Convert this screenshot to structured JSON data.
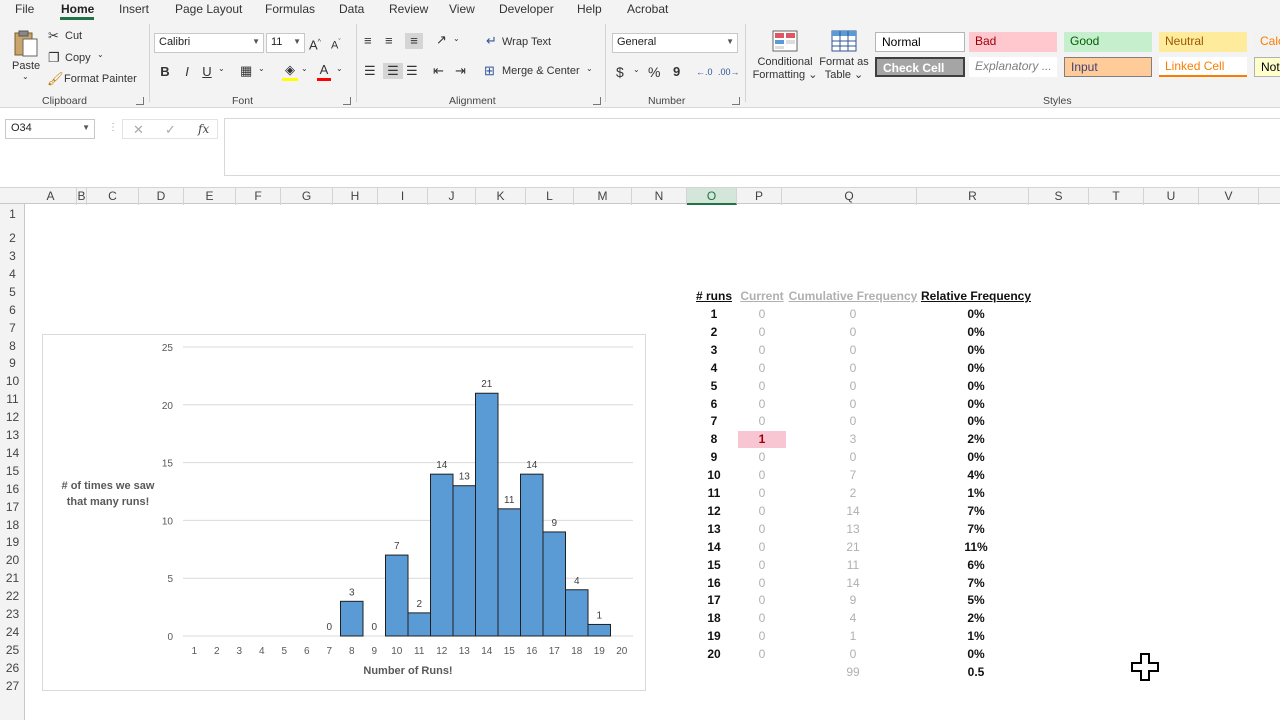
{
  "menu": [
    "File",
    "Home",
    "Insert",
    "Page Layout",
    "Formulas",
    "Data",
    "Review",
    "View",
    "Developer",
    "Help",
    "Acrobat"
  ],
  "ribbon": {
    "clipboard": {
      "paste": "Paste",
      "cut": "Cut",
      "copy": "Copy",
      "format_painter": "Format Painter",
      "label": "Clipboard"
    },
    "font": {
      "name": "Calibri",
      "size": "11",
      "bold": "B",
      "italic": "I",
      "underline": "U",
      "label": "Font"
    },
    "alignment": {
      "wrap_text": "Wrap Text",
      "merge_center": "Merge & Center",
      "label": "Alignment"
    },
    "number": {
      "format": "General",
      "currency": "$",
      "percent": "%",
      "comma": "9",
      "label": "Number"
    },
    "styles": {
      "conditional_formatting": [
        "Conditional",
        "Formatting"
      ],
      "format_as_table": [
        "Format as",
        "Table"
      ],
      "label": "Styles",
      "cells": [
        {
          "text": "Normal",
          "bg": "#ffffff",
          "color": "#000000"
        },
        {
          "text": "Bad",
          "bg": "#ffc7ce",
          "color": "#9c0006"
        },
        {
          "text": "Good",
          "bg": "#c6efce",
          "color": "#006100"
        },
        {
          "text": "Neutral",
          "bg": "#ffeb9c",
          "color": "#9c5700"
        },
        {
          "text": "Calc",
          "bg": "#f2f2f2",
          "color": "#fa7d00"
        },
        {
          "text": "Check Cell",
          "bg": "#a5a5a5",
          "color": "#ffffff"
        },
        {
          "text": "Explanatory ...",
          "bg": "#ffffff",
          "color": "#7f7f7f"
        },
        {
          "text": "Input",
          "bg": "#ffcc99",
          "color": "#3f3f76"
        },
        {
          "text": "Linked Cell",
          "bg": "#ffffff",
          "color": "#fa7d00"
        },
        {
          "text": "Note",
          "bg": "#ffffcc",
          "color": "#000000"
        }
      ]
    }
  },
  "formula_bar": {
    "name_box": "O34",
    "fx": "fx",
    "formula": ""
  },
  "columns": [
    "A",
    "B",
    "C",
    "D",
    "E",
    "F",
    "G",
    "H",
    "I",
    "J",
    "K",
    "L",
    "M",
    "N",
    "O",
    "P",
    "Q",
    "R",
    "S",
    "T",
    "U",
    "V"
  ],
  "selected_column": "O",
  "rows": [
    "1",
    "2",
    "3",
    "4",
    "5",
    "6",
    "7",
    "8",
    "9",
    "10",
    "11",
    "12",
    "13",
    "14",
    "15",
    "16",
    "17",
    "18",
    "19",
    "20",
    "21",
    "22",
    "23",
    "24",
    "25",
    "26",
    "27"
  ],
  "table": {
    "headers": [
      "# runs",
      "Current",
      "Cumulative Frequency",
      "Relative Frequency"
    ],
    "rows": [
      [
        "1",
        "0",
        "0",
        "0%"
      ],
      [
        "2",
        "0",
        "0",
        "0%"
      ],
      [
        "3",
        "0",
        "0",
        "0%"
      ],
      [
        "4",
        "0",
        "0",
        "0%"
      ],
      [
        "5",
        "0",
        "0",
        "0%"
      ],
      [
        "6",
        "0",
        "0",
        "0%"
      ],
      [
        "7",
        "0",
        "0",
        "0%"
      ],
      [
        "8",
        "1",
        "3",
        "2%"
      ],
      [
        "9",
        "0",
        "0",
        "0%"
      ],
      [
        "10",
        "0",
        "7",
        "4%"
      ],
      [
        "11",
        "0",
        "2",
        "1%"
      ],
      [
        "12",
        "0",
        "14",
        "7%"
      ],
      [
        "13",
        "0",
        "13",
        "7%"
      ],
      [
        "14",
        "0",
        "21",
        "11%"
      ],
      [
        "15",
        "0",
        "11",
        "6%"
      ],
      [
        "16",
        "0",
        "14",
        "7%"
      ],
      [
        "17",
        "0",
        "9",
        "5%"
      ],
      [
        "18",
        "0",
        "4",
        "2%"
      ],
      [
        "19",
        "0",
        "1",
        "1%"
      ],
      [
        "20",
        "0",
        "0",
        "0%"
      ]
    ],
    "total_cumulative": "99",
    "total_relative": "0.5",
    "highlight_color": "#f8c6d2"
  },
  "chart_data": {
    "type": "bar",
    "categories": [
      "1",
      "2",
      "3",
      "4",
      "5",
      "6",
      "7",
      "8",
      "9",
      "10",
      "11",
      "12",
      "13",
      "14",
      "15",
      "16",
      "17",
      "18",
      "19",
      "20"
    ],
    "values": [
      null,
      null,
      null,
      null,
      null,
      null,
      0,
      3,
      0,
      7,
      2,
      14,
      13,
      21,
      11,
      14,
      9,
      4,
      1,
      null
    ],
    "data_labels": [
      "",
      "",
      "",
      "",
      "",
      "",
      "0",
      "3",
      "0",
      "7",
      "2",
      "14",
      "13",
      "21",
      "11",
      "14",
      "9",
      "4",
      "1",
      ""
    ],
    "xlabel": "Number of Runs!",
    "ylabel": [
      "# of times we saw",
      "that many runs!"
    ],
    "ylim": [
      0,
      25
    ],
    "yticks": [
      0,
      5,
      10,
      15,
      20,
      25
    ],
    "grid": true,
    "bar_color": "#5b9bd5"
  }
}
